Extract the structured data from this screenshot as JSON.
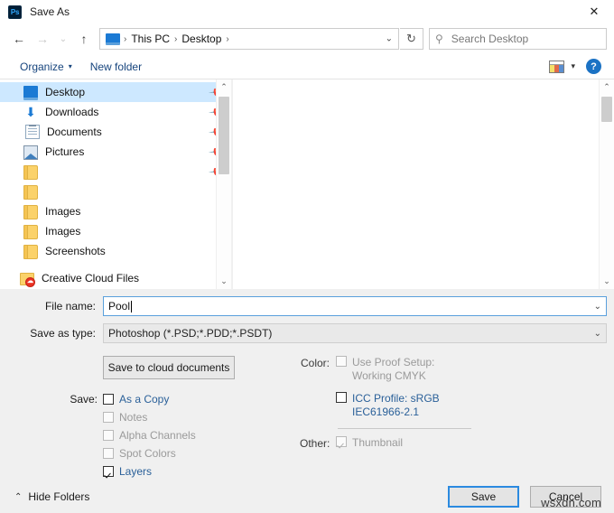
{
  "window": {
    "app_icon": "photoshop-icon",
    "title": "Save As",
    "close_label": "✕"
  },
  "nav": {
    "back_icon": "←",
    "forward_icon": "→",
    "recent_icon": "⌄",
    "up_icon": "↑",
    "refresh_icon": "↻",
    "address_caret": "⌄",
    "breadcrumb_icon": "desktop-icon",
    "breadcrumbs": [
      "This PC",
      "Desktop"
    ],
    "separator": "›"
  },
  "search": {
    "placeholder": "Search Desktop",
    "value": "",
    "icon": "search-icon"
  },
  "commandbar": {
    "organize_label": "Organize",
    "organize_caret": "▾",
    "new_folder_label": "New folder",
    "view_icon": "view-layout-icon",
    "view_caret": "▾",
    "help_label": "?"
  },
  "sidebar": {
    "items": [
      {
        "label": "Desktop",
        "icon": "desktop-icon",
        "pinned": true,
        "selected": true
      },
      {
        "label": "Downloads",
        "icon": "download-icon",
        "pinned": true,
        "selected": false
      },
      {
        "label": "Documents",
        "icon": "document-icon",
        "pinned": true,
        "selected": false
      },
      {
        "label": "Pictures",
        "icon": "pictures-icon",
        "pinned": true,
        "selected": false
      },
      {
        "label": "",
        "icon": "folder-icon",
        "pinned": true,
        "selected": false
      },
      {
        "label": "",
        "icon": "folder-icon",
        "pinned": false,
        "selected": false
      },
      {
        "label": "Images",
        "icon": "folder-icon",
        "pinned": false,
        "selected": false
      },
      {
        "label": "Images",
        "icon": "folder-icon",
        "pinned": false,
        "selected": false
      },
      {
        "label": "Screenshots",
        "icon": "folder-icon",
        "pinned": false,
        "selected": false
      },
      {
        "label": "Creative Cloud Files",
        "icon": "creative-cloud-folder-icon",
        "pinned": false,
        "selected": false
      }
    ],
    "scroll_up_icon": "⌃",
    "scroll_down_icon": "⌄"
  },
  "filepane": {
    "scroll_up_icon": "⌃",
    "scroll_down_icon": "⌄",
    "items": []
  },
  "form": {
    "filename_label": "File name:",
    "filename_value": "Pool",
    "filetype_label": "Save as type:",
    "filetype_value": "Photoshop (*.PSD;*.PDD;*.PSDT)",
    "dropdown_caret": "⌄"
  },
  "options": {
    "cloud_button_label": "Save to cloud documents",
    "save_group_label": "Save:",
    "save_checkboxes": [
      {
        "label": "As a Copy",
        "checked": false,
        "enabled": true
      },
      {
        "label": "Notes",
        "checked": false,
        "enabled": false
      },
      {
        "label": "Alpha Channels",
        "checked": false,
        "enabled": false
      },
      {
        "label": "Spot Colors",
        "checked": false,
        "enabled": false
      },
      {
        "label": "Layers",
        "checked": true,
        "enabled": true
      }
    ],
    "color_group_label": "Color:",
    "proof_setup_label": "Use Proof Setup:",
    "proof_setup_value": "Working CMYK",
    "proof_setup_checked": false,
    "proof_setup_enabled": false,
    "icc_profile_label": "ICC Profile:  sRGB",
    "icc_profile_value": "IEC61966-2.1",
    "icc_profile_checked": false,
    "icc_profile_enabled": true,
    "other_group_label": "Other:",
    "thumbnail_label": "Thumbnail",
    "thumbnail_checked": true,
    "thumbnail_enabled": false
  },
  "footer": {
    "hide_folders_label": "Hide Folders",
    "hide_folders_caret": "⌃",
    "save_label": "Save",
    "cancel_label": "Cancel"
  },
  "watermark": {
    "text": "wsxdn.com"
  },
  "colors": {
    "accent": "#2b8ae0",
    "link": "#2a6099",
    "selection": "#cde8ff",
    "disabled": "#9a9a9a",
    "chrome": "#f0f0f0"
  }
}
